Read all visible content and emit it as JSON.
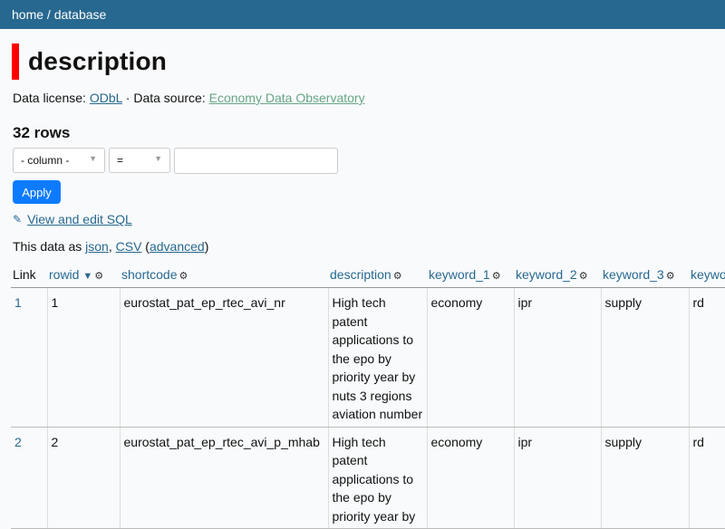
{
  "breadcrumb": {
    "home": "home",
    "sep": " / ",
    "database": "database"
  },
  "page": {
    "title": "description"
  },
  "meta": {
    "license_label": "Data license:",
    "license_link": "ODbL",
    "source_sep": " · ",
    "source_label": "Data source:",
    "source_link": "Economy Data Observatory"
  },
  "row_count": "32 rows",
  "filters": {
    "column_value": "- column -",
    "op_value": "=",
    "apply_label": "Apply"
  },
  "sql_link": "View and edit SQL",
  "export": {
    "prefix": "This data as ",
    "json": "json",
    "sep": ", ",
    "csv": "CSV",
    "open": " (",
    "advanced": "advanced",
    "close": ")"
  },
  "table": {
    "headers": [
      "Link",
      "rowid",
      "shortcode",
      "description",
      "keyword_1",
      "keyword_2",
      "keyword_3",
      "keywo"
    ],
    "sort_indicator": "▼",
    "rows": [
      {
        "link": "1",
        "rowid": "1",
        "shortcode": "eurostat_pat_ep_rtec_avi_nr",
        "description": "High tech patent applications to the epo by priority year by nuts 3 regions aviation number",
        "keyword_1": "economy",
        "keyword_2": "ipr",
        "keyword_3": "supply",
        "keyword_4": "rd"
      },
      {
        "link": "2",
        "rowid": "2",
        "shortcode": "eurostat_pat_ep_rtec_avi_p_mhab",
        "description": "High tech patent applications to the epo by priority year by",
        "keyword_1": "economy",
        "keyword_2": "ipr",
        "keyword_3": "supply",
        "keyword_4": "rd"
      }
    ]
  },
  "icons": {
    "gear": "gear-icon",
    "pencil": "pencil-icon"
  },
  "colors": {
    "header_bg": "#276890",
    "accent_bar": "#ff0000",
    "apply_bg": "#0d7bff",
    "source_link": "#67a683"
  }
}
